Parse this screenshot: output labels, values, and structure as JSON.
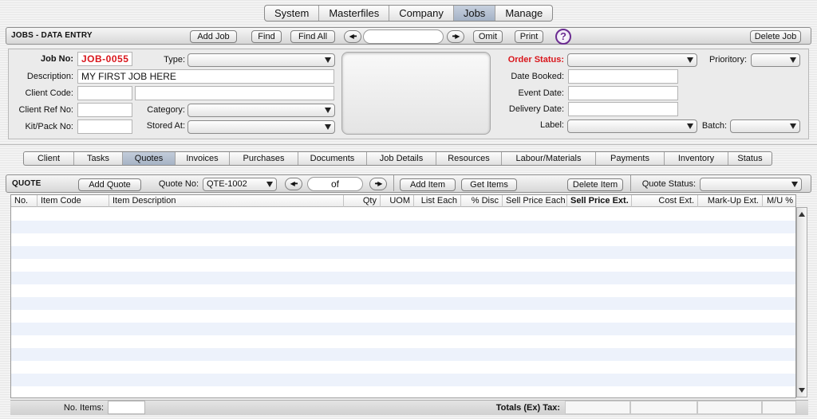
{
  "top_menu": [
    "System",
    "Masterfiles",
    "Company",
    "Jobs",
    "Manage"
  ],
  "top_menu_active": "Jobs",
  "header": {
    "title": "JOBS - DATA ENTRY",
    "add_job": "Add Job",
    "find": "Find",
    "find_all": "Find All",
    "omit": "Omit",
    "print": "Print",
    "help": "?",
    "delete_job": "Delete Job",
    "prev_glyph": "◀••",
    "next_glyph": "••▶",
    "search_value": ""
  },
  "form": {
    "job_no_label": "Job No:",
    "job_no": "JOB-0055",
    "description_label": "Description:",
    "description": "MY FIRST JOB HERE",
    "client_code_label": "Client Code:",
    "client_code": "",
    "client_name": "",
    "client_ref_label": "Client Ref No:",
    "client_ref": "",
    "kit_pack_label": "Kit/Pack No:",
    "kit_pack": "",
    "type_label": "Type:",
    "type_value": "",
    "category_label": "Category:",
    "category_value": "",
    "stored_at_label": "Stored At:",
    "stored_at_value": "",
    "order_status_label": "Order Status:",
    "order_status_value": "",
    "priority_label": "Prioritory:",
    "priority_value": "",
    "date_booked_label": "Date Booked:",
    "date_booked": "",
    "event_date_label": "Event Date:",
    "event_date": "",
    "delivery_date_label": "Delivery Date:",
    "delivery_date": "",
    "label_label": "Label:",
    "label_value": "",
    "batch_label": "Batch:",
    "batch_value": ""
  },
  "tabs": [
    "Client",
    "Tasks",
    "Quotes",
    "Invoices",
    "Purchases",
    "Documents",
    "Job Details",
    "Resources",
    "Labour/Materials",
    "Payments",
    "Inventory",
    "Status"
  ],
  "active_tab": "Quotes",
  "quote": {
    "title": "QUOTE",
    "add_quote": "Add Quote",
    "quote_no_label": "Quote No:",
    "quote_no_value": "QTE-1002",
    "of_text": "of",
    "add_item": "Add Item",
    "get_items": "Get Items",
    "delete_item": "Delete Item",
    "quote_status_label": "Quote Status:",
    "quote_status_value": ""
  },
  "table": {
    "columns": [
      "No.",
      "Item Code",
      "Item Description",
      "Qty",
      "UOM",
      "List Each",
      "% Disc",
      "Sell Price Each",
      "Sell Price Ext.",
      "Cost Ext.",
      "Mark-Up Ext.",
      "M/U %"
    ],
    "rows": []
  },
  "footer": {
    "no_items_label": "No. Items:",
    "no_items": "",
    "totals_label": "Totals (Ex) Tax:"
  }
}
